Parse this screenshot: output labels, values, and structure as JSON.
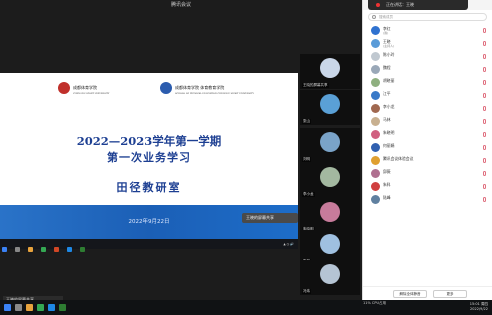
{
  "window": {
    "title": "腾讯会议"
  },
  "floating_bar": {
    "text": "正在讲话：王晓"
  },
  "slide": {
    "logo_left": "成都体育学院",
    "logo_left_sub": "CHENGDU SPORT UNIVERSITY",
    "logo_right": "成都体育学院 体育教育学院",
    "logo_right_sub": "SCHOOL OF PHYSICAL EDUCATION CHENGDU SPORT UNIVERSITY",
    "title": "2022—2023学年第一学期",
    "subtitle": "第一次业务学习",
    "dept": "田径教研室",
    "date": "2022年9月22日",
    "float_label": "王晓的屏幕共享"
  },
  "share_label": "王晓的屏幕共享",
  "videos": [
    {
      "name": "王晓的屏幕共享",
      "color": "#c9d6e8"
    },
    {
      "name": "张山",
      "color": "#5aa0d6"
    },
    {
      "name": "刘明",
      "color": "#7aa3c8"
    },
    {
      "name": "李小龙",
      "color": "#a3b8a0"
    },
    {
      "name": "朱晓明",
      "color": "#c77b9b"
    },
    {
      "name": "张某",
      "color": "#9fc0e0"
    },
    {
      "name": "冯炜",
      "color": "#b5c4d4"
    }
  ],
  "participants": {
    "header": "成员(34)",
    "search_placeholder": "搜索成员",
    "list": [
      {
        "name": "李红",
        "sub": "(我)",
        "color": "#2f72d0"
      },
      {
        "name": "王晓",
        "sub": "(主持人)",
        "color": "#5a9bd8"
      },
      {
        "name": "陈小玲",
        "sub": "",
        "color": "#c0c8d0"
      },
      {
        "name": "魏程",
        "sub": "",
        "color": "#9aa8b8"
      },
      {
        "name": "胡晓丽",
        "sub": "",
        "color": "#8fb080"
      },
      {
        "name": "江平",
        "sub": "",
        "color": "#3a7ac8"
      },
      {
        "name": "李小龙",
        "sub": "",
        "color": "#a06850"
      },
      {
        "name": "马林",
        "sub": "",
        "color": "#c8b090"
      },
      {
        "name": "朱晓明",
        "sub": "",
        "color": "#d06080"
      },
      {
        "name": "何丽娟",
        "sub": "",
        "color": "#3060b0"
      },
      {
        "name": "腾讯会议体验会议",
        "sub": "",
        "color": "#e0a030"
      },
      {
        "name": "邱薇",
        "sub": "",
        "color": "#b07090"
      },
      {
        "name": "朱科",
        "sub": "",
        "color": "#d04040"
      },
      {
        "name": "陆峰",
        "sub": "",
        "color": "#6080a0"
      }
    ],
    "btn_mute": "解除全体静音",
    "btn_more": "更多"
  },
  "taskbar": {
    "tray": "11% CPU占用",
    "time": "15:01 周四",
    "date": "2022/9/22"
  }
}
